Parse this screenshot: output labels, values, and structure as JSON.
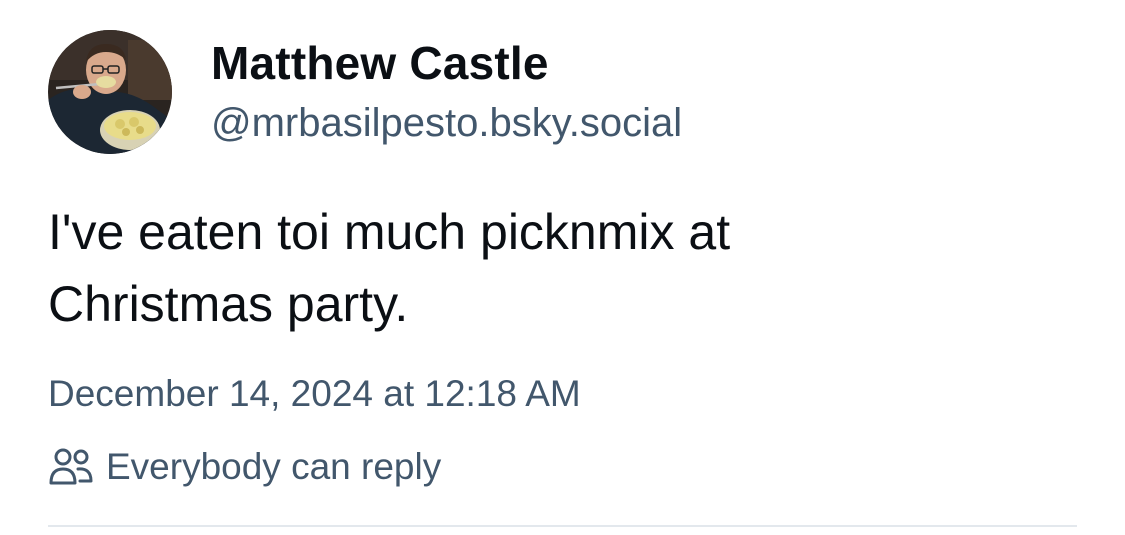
{
  "post": {
    "author": {
      "display_name": "Matthew Castle",
      "handle": "@mrbasilpesto.bsky.social"
    },
    "text_lines": [
      "I've eaten toi much picknmix at",
      "Christmas party."
    ],
    "timestamp": "December 14, 2024 at 12:18 AM",
    "reply_setting": {
      "icon": "people-icon",
      "label": "Everybody can reply"
    }
  },
  "colors": {
    "name_text": "#0b0f14",
    "secondary_text": "#42576c",
    "divider": "#e3e8ed"
  }
}
